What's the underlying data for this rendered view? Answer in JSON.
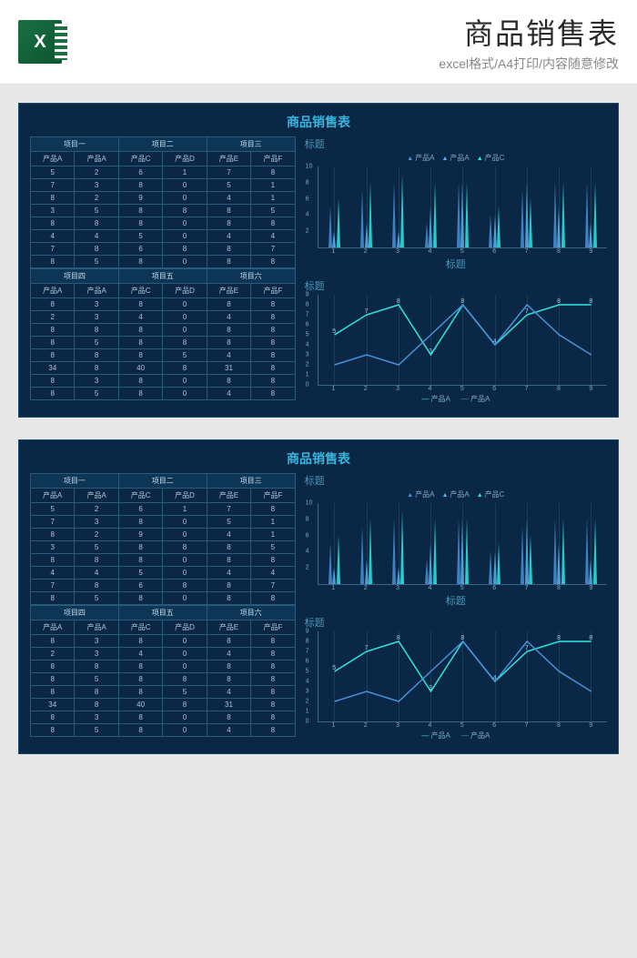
{
  "header": {
    "icon_text": "X",
    "title": "商品销售表",
    "subtitle": "excel格式/A4打印/内容随意修改"
  },
  "sheet": {
    "title": "商品销售表",
    "group_headers_1": [
      "项目一",
      "项目二",
      "项目三"
    ],
    "group_headers_2": [
      "项目四",
      "项目五",
      "项目六"
    ],
    "col_headers": [
      "产品A",
      "产品A",
      "产品C",
      "产品D",
      "产品E",
      "产品F"
    ],
    "table1_rows": [
      [
        "5",
        "2",
        "6",
        "1",
        "7",
        "8"
      ],
      [
        "7",
        "3",
        "8",
        "0",
        "5",
        "1"
      ],
      [
        "8",
        "2",
        "9",
        "0",
        "4",
        "1"
      ],
      [
        "3",
        "5",
        "8",
        "8",
        "8",
        "5"
      ],
      [
        "8",
        "8",
        "8",
        "0",
        "8",
        "8"
      ],
      [
        "4",
        "4",
        "5",
        "0",
        "4",
        "4"
      ],
      [
        "7",
        "8",
        "6",
        "8",
        "8",
        "7"
      ],
      [
        "8",
        "5",
        "8",
        "0",
        "8",
        "8"
      ]
    ],
    "table2_rows": [
      [
        "8",
        "3",
        "8",
        "0",
        "8",
        "8"
      ],
      [
        "2",
        "3",
        "4",
        "0",
        "4",
        "8"
      ],
      [
        "8",
        "8",
        "8",
        "0",
        "8",
        "8"
      ],
      [
        "8",
        "5",
        "8",
        "8",
        "8",
        "8"
      ],
      [
        "8",
        "8",
        "8",
        "5",
        "4",
        "8"
      ],
      [
        "34",
        "8",
        "40",
        "8",
        "31",
        "8"
      ],
      [
        "8",
        "3",
        "8",
        "0",
        "8",
        "8"
      ],
      [
        "8",
        "5",
        "8",
        "0",
        "4",
        "8"
      ]
    ]
  },
  "chart_data": [
    {
      "type": "area",
      "title": "标题",
      "legend": [
        "产品A",
        "产品A",
        "产品C"
      ],
      "x": [
        "1",
        "2",
        "3",
        "4",
        "5",
        "6",
        "7",
        "8",
        "9"
      ],
      "ylim": [
        0,
        10
      ],
      "yticks": [
        "10",
        "8",
        "6",
        "4",
        "2"
      ],
      "xlabel": "标题",
      "series": [
        {
          "name": "产品A",
          "color": "#4a90d9",
          "values": [
            5,
            7,
            8,
            3,
            8,
            4,
            7,
            8,
            8
          ]
        },
        {
          "name": "产品A",
          "color": "#5ab0e8",
          "values": [
            2,
            3,
            2,
            5,
            8,
            4,
            8,
            5,
            3
          ]
        },
        {
          "name": "产品C",
          "color": "#2ee8e0",
          "values": [
            6,
            8,
            9,
            8,
            8,
            5,
            6,
            8,
            8
          ]
        }
      ]
    },
    {
      "type": "line",
      "title": "标题",
      "legend": [
        "产品A",
        "产品A"
      ],
      "x": [
        "1",
        "2",
        "3",
        "4",
        "5",
        "6",
        "7",
        "8",
        "9"
      ],
      "ylim": [
        0,
        9
      ],
      "yticks": [
        "9",
        "8",
        "7",
        "6",
        "5",
        "4",
        "3",
        "2",
        "1",
        "0"
      ],
      "series": [
        {
          "name": "产品A",
          "color": "#2ee8e0",
          "values": [
            5,
            7,
            8,
            3,
            8,
            4,
            7,
            8,
            8
          ]
        },
        {
          "name": "产品A",
          "color": "#4a90d9",
          "values": [
            2,
            3,
            2,
            5,
            8,
            4,
            8,
            5,
            3
          ]
        }
      ]
    }
  ]
}
